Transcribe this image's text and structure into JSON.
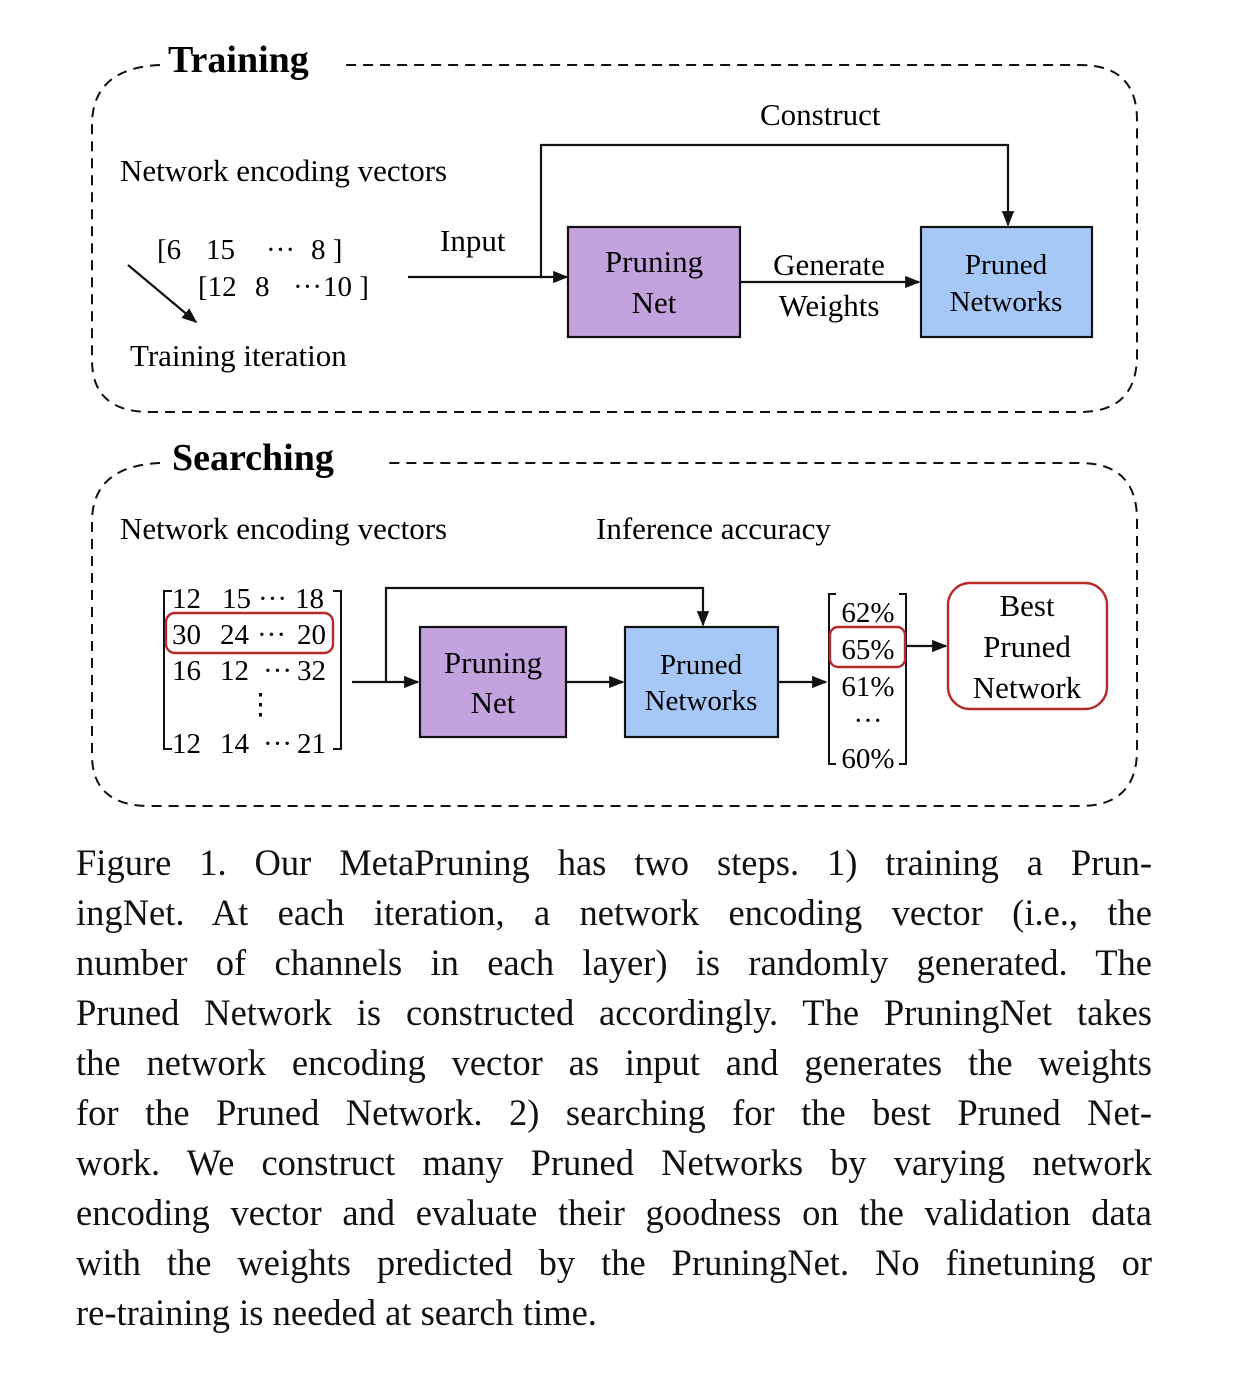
{
  "colors": {
    "pruning_net_fill": "#c3a3dd",
    "pruned_networks_fill": "#a6c8f7",
    "highlight_red": "#b82a2a",
    "stroke": "#111111"
  },
  "training": {
    "title": "Training",
    "encoding_label": "Network encoding vectors",
    "vector_row1": [
      "[6",
      "15",
      "···",
      "8 ]"
    ],
    "vector_row2": [
      "[12",
      "8",
      "···",
      "10 ]"
    ],
    "iteration_label": "Training iteration",
    "input_label": "Input",
    "construct_label": "Construct",
    "pruning_net": [
      "Pruning",
      "Net"
    ],
    "generate_label": [
      "Generate",
      "Weights"
    ],
    "pruned_networks": [
      "Pruned",
      "Networks"
    ]
  },
  "searching": {
    "title": "Searching",
    "encoding_label": "Network encoding vectors",
    "accuracy_label": "Inference accuracy",
    "matrix_rows": [
      [
        "12",
        "15",
        "···",
        "18"
      ],
      [
        "30",
        "24",
        "···",
        "20"
      ],
      [
        "16",
        "12",
        "···",
        "32"
      ],
      [
        "⋮"
      ],
      [
        "12",
        "14",
        "···",
        "21"
      ]
    ],
    "highlighted_row_index": 1,
    "pruning_net": [
      "Pruning",
      "Net"
    ],
    "pruned_networks": [
      "Pruned",
      "Networks"
    ],
    "accuracies": [
      "62%",
      "65%",
      "61%",
      "···",
      "60%"
    ],
    "highlighted_accuracy_index": 1,
    "best": [
      "Best",
      "Pruned",
      "Network"
    ]
  },
  "caption": {
    "lines": [
      "Figure 1. Our MetaPruning has two steps.  1) training a Prun-",
      "ingNet.  At each iteration, a network encoding vector (i.e., the",
      "number of channels in each layer) is randomly generated.  The",
      "Pruned Network is constructed accordingly. The PruningNet takes",
      "the network encoding vector as input and generates the weights",
      "for the Pruned Network.  2) searching for the best Pruned Net-",
      "work.  We construct many Pruned Networks by varying network",
      "encoding vector and evaluate their goodness on the validation data",
      "with the weights predicted by the PruningNet.  No finetuning or",
      "re-training is needed at search time."
    ]
  }
}
